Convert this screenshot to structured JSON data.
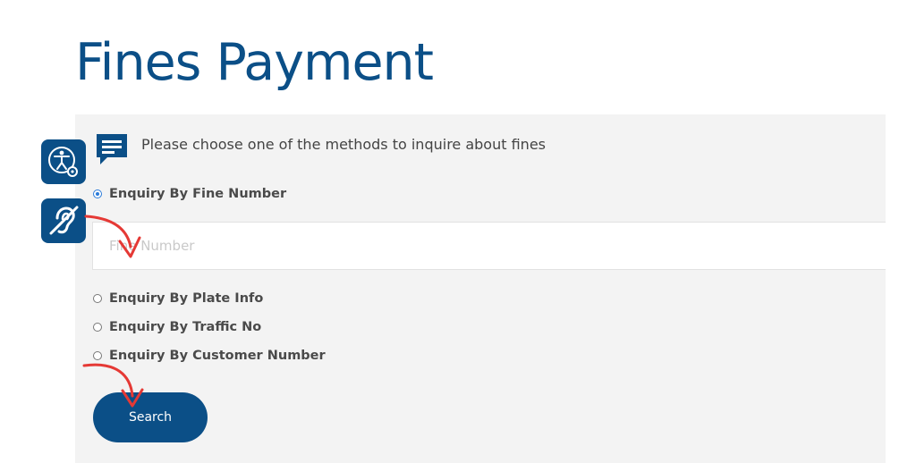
{
  "page": {
    "title": "Fines Payment"
  },
  "info": {
    "text": "Please choose one of the methods to inquire about fines",
    "icon": "chat-message-icon"
  },
  "options": [
    {
      "label": "Enquiry By Fine Number",
      "selected": true
    },
    {
      "label": "Enquiry By Plate Info",
      "selected": false
    },
    {
      "label": "Enquiry By Traffic No",
      "selected": false
    },
    {
      "label": "Enquiry By Customer Number",
      "selected": false
    }
  ],
  "fine_number_input": {
    "placeholder": "Fine Number",
    "value": ""
  },
  "search_button": {
    "label": "Search"
  },
  "accessibility": {
    "buttons": [
      {
        "icon": "accessibility-settings-icon"
      },
      {
        "icon": "hearing-impaired-icon"
      }
    ]
  },
  "colors": {
    "brand": "#0b4f87",
    "panel_background": "#f3f3f3",
    "radio_selected": "#2b7bd9",
    "annotation_arrow": "#e53935"
  }
}
